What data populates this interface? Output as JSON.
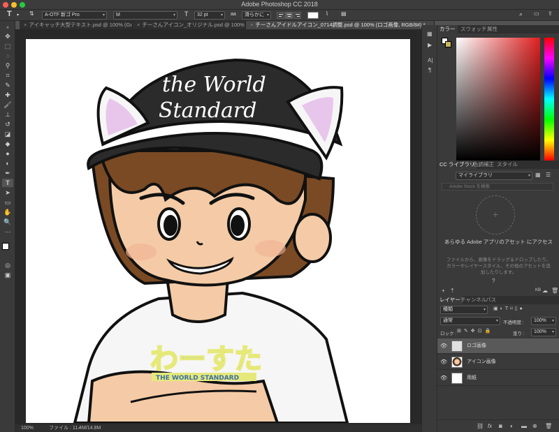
{
  "window": {
    "title": "Adobe Photoshop CC 2018"
  },
  "options_bar": {
    "tool_glyph": "T",
    "font_family": "A-OTF 新ゴ Pro",
    "font_style": "M",
    "font_size": "32 pt",
    "antialias_label": "aa",
    "antialias_value": "滑らかに",
    "text_color": "#ffffff"
  },
  "tabs": [
    {
      "label": "アイキャッチ大型テキスト.psd @ 100% (Goo...",
      "active": false
    },
    {
      "label": "チーさんアイコン_オリジナル.psd @ 100% (...",
      "active": false
    },
    {
      "label": "チーさんアイドルアイコン_0714調整.psd @ 100% (ロゴ画像, RGB/8#) *",
      "active": true
    }
  ],
  "illustration": {
    "cap_text_line1": "the World",
    "cap_text_line2": "Standard",
    "shirt_logo": "わーすた",
    "shirt_subtext": "THE WORLD STANDARD"
  },
  "status": {
    "zoom": "100%",
    "file_info": "ファイル : 11.4M/14.8M"
  },
  "color_panel": {
    "tabs": [
      "カラー",
      "スウォッチ",
      "属性"
    ]
  },
  "library_panel": {
    "tabs": [
      "CC ライブラリ",
      "色調補正",
      "スタイル"
    ],
    "library_select": "マイライブラリ",
    "search_placeholder": "Adobe Stock を検索",
    "heading": "あらゆる Adobe アプリのアセット にアクセス",
    "body": "ファイルから、画像をドラッグ＆ドロップしたり、カラーやレイヤースタイル、その他のアセットを追加したりします。",
    "size_label": "KB"
  },
  "layers_panel": {
    "tabs": [
      "レイヤー",
      "チャンネル",
      "パス"
    ],
    "filter_kind": "種類",
    "blend_mode": "通常",
    "opacity_label": "不透明度 :",
    "opacity_value": "100%",
    "lock_label": "ロック :",
    "fill_label": "塗り :",
    "fill_value": "100%",
    "layers": [
      {
        "name": "ロゴ画像",
        "selected": true
      },
      {
        "name": "アイコン画像",
        "selected": false
      },
      {
        "name": "用紙",
        "selected": false
      }
    ]
  }
}
